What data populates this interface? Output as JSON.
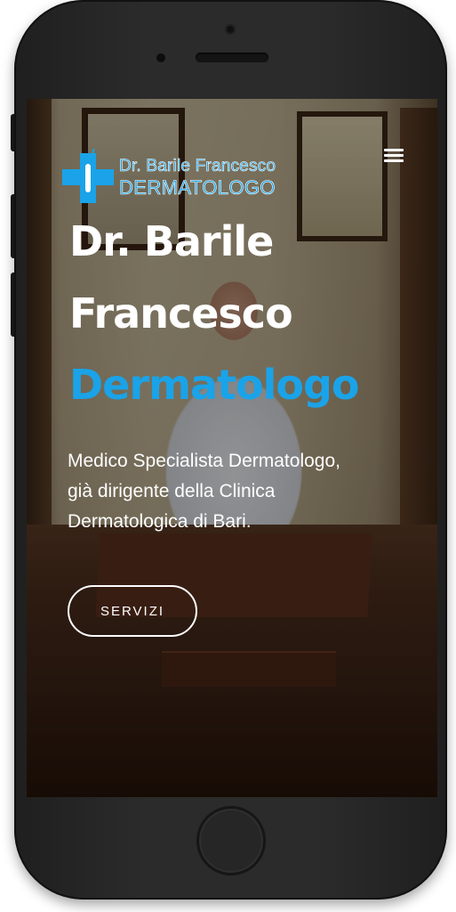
{
  "logo": {
    "line1": "Dr. Barile Francesco",
    "line2": "DERMATOLOGO",
    "icon": "medical-cross-follicle-icon",
    "color": "#1aa3e8"
  },
  "nav": {
    "menu_icon": "hamburger-menu-icon"
  },
  "hero": {
    "title_line1": "Dr. Barile",
    "title_line2": "Francesco",
    "title_line3": "Dermatologo",
    "description": [
      "Medico Specialista Dermatologo,",
      "già dirigente della Clinica",
      "Dermatologica di Bari."
    ],
    "button_label": "SERVIZI",
    "accent_color": "#1aa3e8"
  }
}
